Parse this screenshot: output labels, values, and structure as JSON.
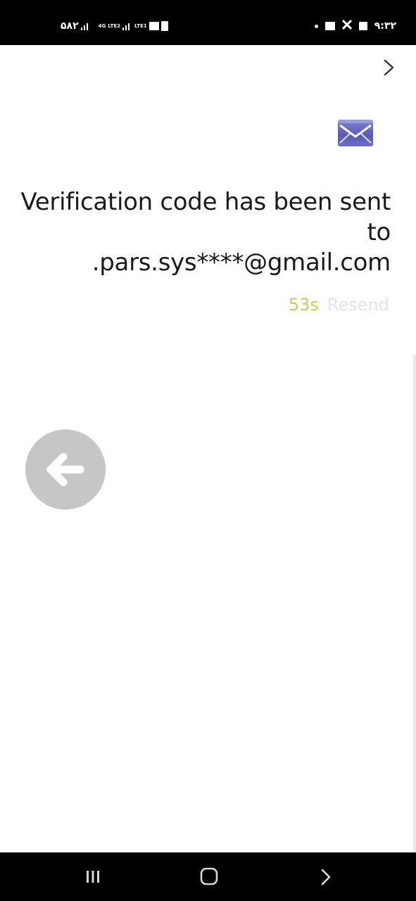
{
  "status_bar": {
    "carrier_text": "۵۸۲",
    "network_1": "4G",
    "network_2": "LTE2",
    "network_3": "LTE1",
    "clock": "۹:۳۲"
  },
  "header": {
    "forward_icon": "chevron-right-icon"
  },
  "verification": {
    "icon": "mail-icon",
    "title_line": "Verification code has been sent to",
    "email": ".pars.sys****@gmail.com",
    "countdown": "53s",
    "resend_label": "Resend"
  },
  "actions": {
    "back_icon": "arrow-left-icon"
  },
  "nav_bar": {
    "recents_icon": "recents-icon",
    "home_icon": "home-icon",
    "back_icon": "back-chevron-icon"
  },
  "colors": {
    "timer": "#c9c85e",
    "resend": "#e3e3e3",
    "fab": "#c6c6c6",
    "mail_icon": "#6b6bc4"
  }
}
